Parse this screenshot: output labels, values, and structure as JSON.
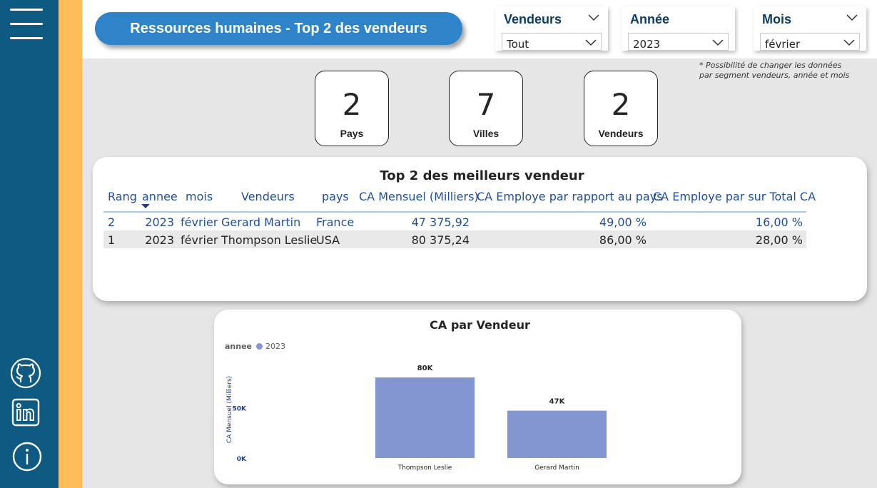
{
  "header": {
    "title": "Ressources humaines - Top 2 des vendeurs"
  },
  "slicers": [
    {
      "label": "Vendeurs",
      "value": "Tout"
    },
    {
      "label": "Année",
      "value": "2023"
    },
    {
      "label": "Mois",
      "value": "février"
    }
  ],
  "note": {
    "line1": "* Possibilité de changer les données",
    "line2": "par segment vendeurs, année et mois"
  },
  "kpis": [
    {
      "value": "2",
      "label": "Pays"
    },
    {
      "value": "7",
      "label": "Villes"
    },
    {
      "value": "2",
      "label": "Vendeurs"
    }
  ],
  "table": {
    "title": "Top 2 des meilleurs vendeur",
    "columns": [
      "Rang",
      "annee",
      "mois",
      "Vendeurs",
      "pays",
      "CA Mensuel (Milliers)",
      "CA Employe par rapport au pays",
      "CA Employe par sur Total CA"
    ],
    "rows": [
      [
        "2",
        "2023",
        "février",
        "Gerard Martin",
        "France",
        "47 375,92",
        "49,00 %",
        "16,00 %"
      ],
      [
        "1",
        "2023",
        "février",
        "Thompson Leslie",
        "USA",
        "80 375,24",
        "86,00 %",
        "28,00 %"
      ]
    ]
  },
  "chart_data": {
    "type": "bar",
    "title": "CA par Vendeur",
    "legend_title": "annee",
    "categories": [
      "Thompson Leslie",
      "Gerard Martin"
    ],
    "series": [
      {
        "name": "2023",
        "values": [
          80,
          47
        ],
        "color": "#8496d1"
      }
    ],
    "data_labels": [
      "80K",
      "47K"
    ],
    "ylabel": "CA Mensuel (Milliers)",
    "yticks": [
      0,
      50
    ],
    "ytick_labels": [
      "0K",
      "50K"
    ],
    "ylim": [
      0,
      80
    ],
    "grid": false,
    "legend_position": "top-left"
  },
  "colors": {
    "sidebar": "#0e5a82",
    "accent": "#ffbd59",
    "title_pill": "#2f84c9",
    "bar": "#8496d1"
  },
  "icons": {
    "menu": "hamburger-menu-icon",
    "github": "github-icon",
    "linkedin": "linkedin-icon",
    "info": "info-icon"
  }
}
